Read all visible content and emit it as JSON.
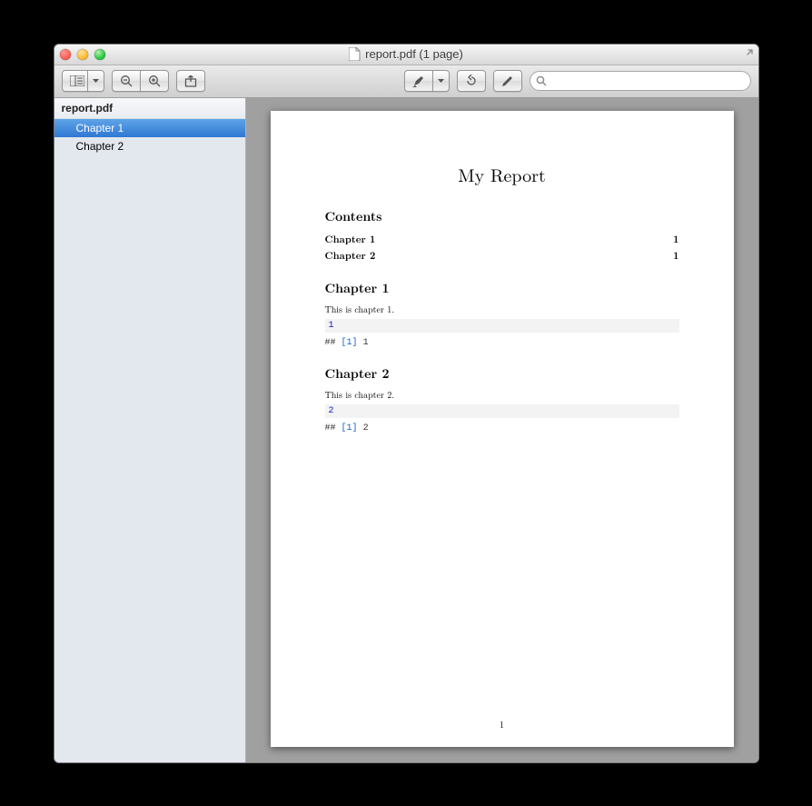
{
  "window": {
    "title": "report.pdf (1 page)"
  },
  "sidebar": {
    "filename": "report.pdf",
    "items": [
      {
        "label": "Chapter 1",
        "selected": true
      },
      {
        "label": "Chapter 2",
        "selected": false
      }
    ]
  },
  "search": {
    "value": "",
    "placeholder": ""
  },
  "document": {
    "title": "My Report",
    "contents_heading": "Contents",
    "toc": [
      {
        "label": "Chapter 1",
        "page": "1"
      },
      {
        "label": "Chapter 2",
        "page": "1"
      }
    ],
    "chapters": [
      {
        "heading": "Chapter 1",
        "body": "This is chapter 1.",
        "code_input": "1",
        "code_output_prefix": "##",
        "code_output_index": "[1]",
        "code_output_value": "1"
      },
      {
        "heading": "Chapter 2",
        "body": "This is chapter 2.",
        "code_input": "2",
        "code_output_prefix": "##",
        "code_output_index": "[1]",
        "code_output_value": "2"
      }
    ],
    "page_number": "1"
  }
}
